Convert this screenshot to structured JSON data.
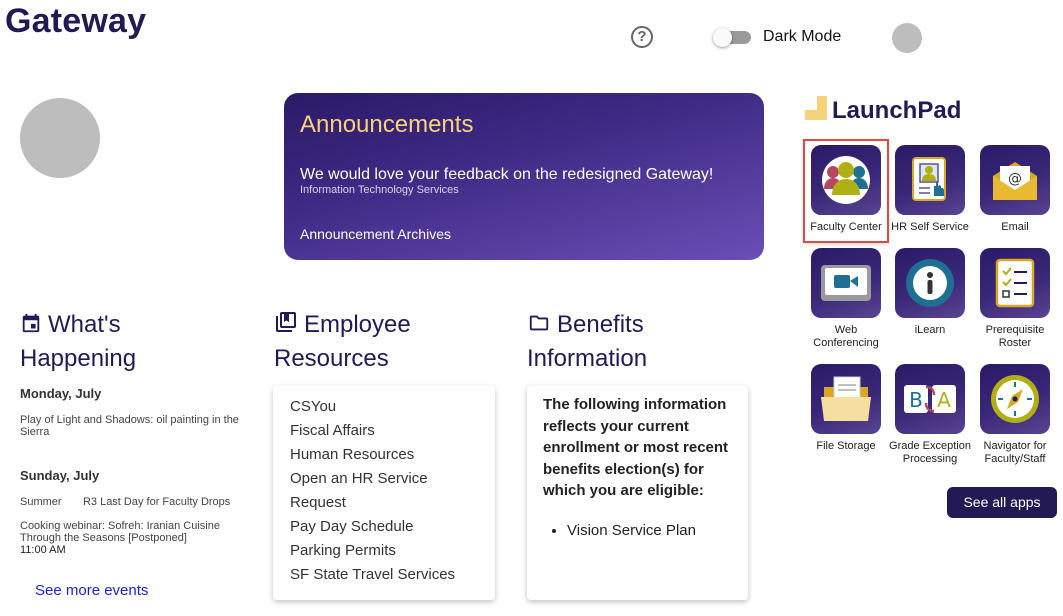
{
  "header": {
    "title": "Gateway",
    "help_icon": "question-circle-icon",
    "dark_mode_label": "Dark Mode",
    "dark_mode_on": false
  },
  "announcements": {
    "title": "Announcements",
    "message": "We would love your feedback on the redesigned Gateway!",
    "source": "Information Technology Services",
    "archives_link": "Announcement Archives"
  },
  "whats_happening": {
    "title_line1": "What's",
    "title_line2": "Happening",
    "icon": "calendar-icon",
    "days": [
      {
        "label": "Monday, July",
        "events": [
          {
            "text": "Play of Light and Shadows: oil painting in the Sierra"
          }
        ]
      },
      {
        "label": "Sunday, July",
        "events": [
          {
            "text": "Summer       R3 Last Day for Faculty Drops"
          },
          {
            "text": "Cooking webinar: Sofreh: Iranian Cuisine Through the Seasons [Postponed]",
            "time": "11:00 AM"
          }
        ]
      }
    ],
    "see_more": "See more events"
  },
  "employee_resources": {
    "title_line1": "Employee",
    "title_line2": "Resources",
    "icon": "library-books-icon",
    "items": [
      "CSYou",
      "Fiscal Affairs",
      "Human Resources",
      "Open an HR Service",
      "Request",
      "Pay Day Schedule",
      "Parking Permits",
      "SF State Travel Services"
    ]
  },
  "benefits": {
    "title_line1": "Benefits",
    "title_line2": "Information",
    "icon": "folder-icon",
    "intro": "The following information reflects your current enrollment or most recent benefits election(s) for which you are eligible:",
    "plans": [
      "Vision Service Plan"
    ]
  },
  "launchpad": {
    "title": "LaunchPad",
    "apps": [
      {
        "label": "Faculty Center",
        "icon": "faculty-group-icon",
        "selected": true
      },
      {
        "label": "HR Self Service",
        "icon": "hr-badge-icon"
      },
      {
        "label": "Email",
        "icon": "email-envelope-icon"
      },
      {
        "label": "Web Conferencing",
        "icon": "video-camera-icon"
      },
      {
        "label": "iLearn",
        "icon": "info-circle-icon"
      },
      {
        "label": "Prerequisite Roster",
        "icon": "checklist-icon"
      },
      {
        "label": "File Storage",
        "icon": "folder-files-icon"
      },
      {
        "label": "Grade Exception Processing",
        "icon": "grade-swap-icon"
      },
      {
        "label": "Navigator for Faculty/Staff",
        "icon": "compass-icon"
      }
    ],
    "see_all": "See all apps"
  }
}
